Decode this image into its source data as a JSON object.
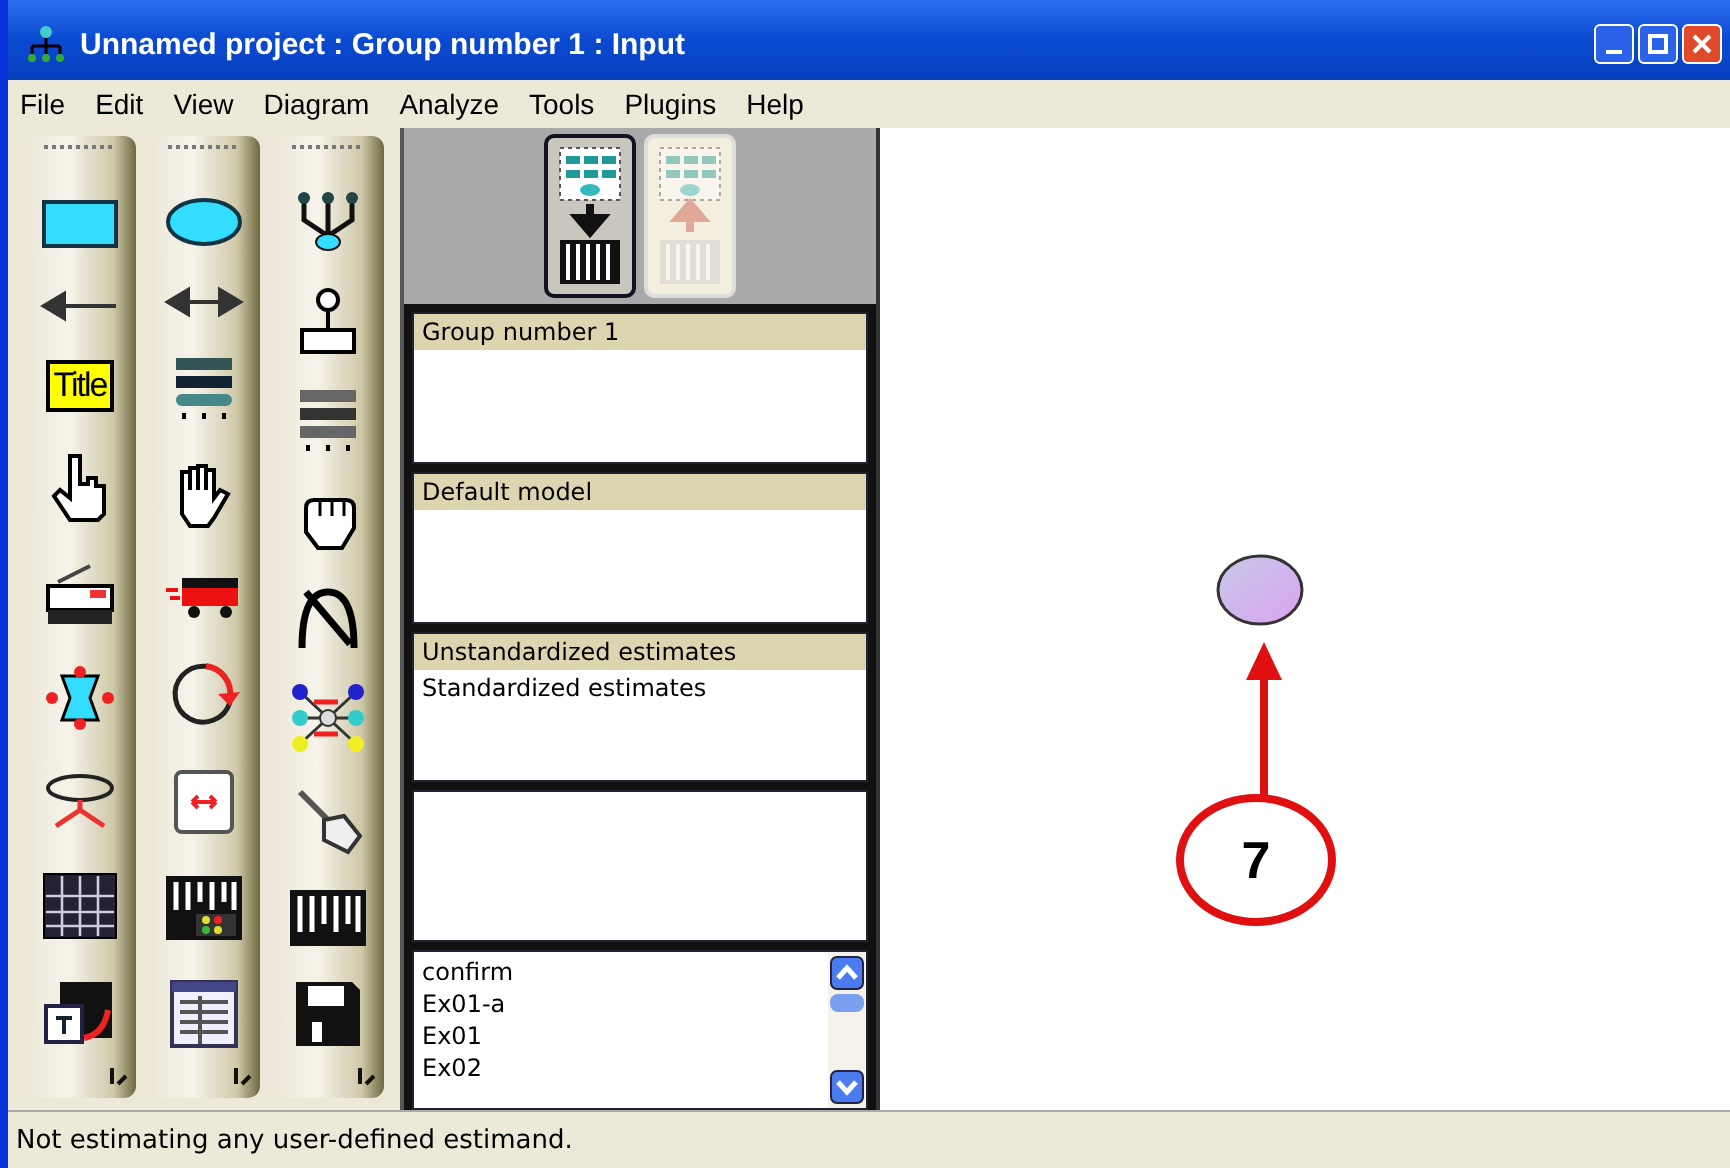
{
  "window": {
    "title": "Unnamed project : Group number 1 : Input"
  },
  "menu": [
    "File",
    "Edit",
    "View",
    "Diagram",
    "Analyze",
    "Tools",
    "Plugins",
    "Help"
  ],
  "toolbox": {
    "title_tool_label": "Title"
  },
  "view_buttons": [
    {
      "kind": "input",
      "selected": true
    },
    {
      "kind": "output",
      "selected": false
    }
  ],
  "groups": [
    {
      "label": "Group number 1",
      "selected": true
    }
  ],
  "models": [
    {
      "label": "Default model",
      "selected": true
    }
  ],
  "estimates": [
    {
      "label": "Unstandardized estimates",
      "selected": true
    },
    {
      "label": "Standardized estimates",
      "selected": false
    }
  ],
  "files": [
    "confirm",
    "Ex01-a",
    "Ex01",
    "Ex02"
  ],
  "canvas": {
    "callout_label": "7"
  },
  "status_bar": "Not estimating any user-defined estimand."
}
